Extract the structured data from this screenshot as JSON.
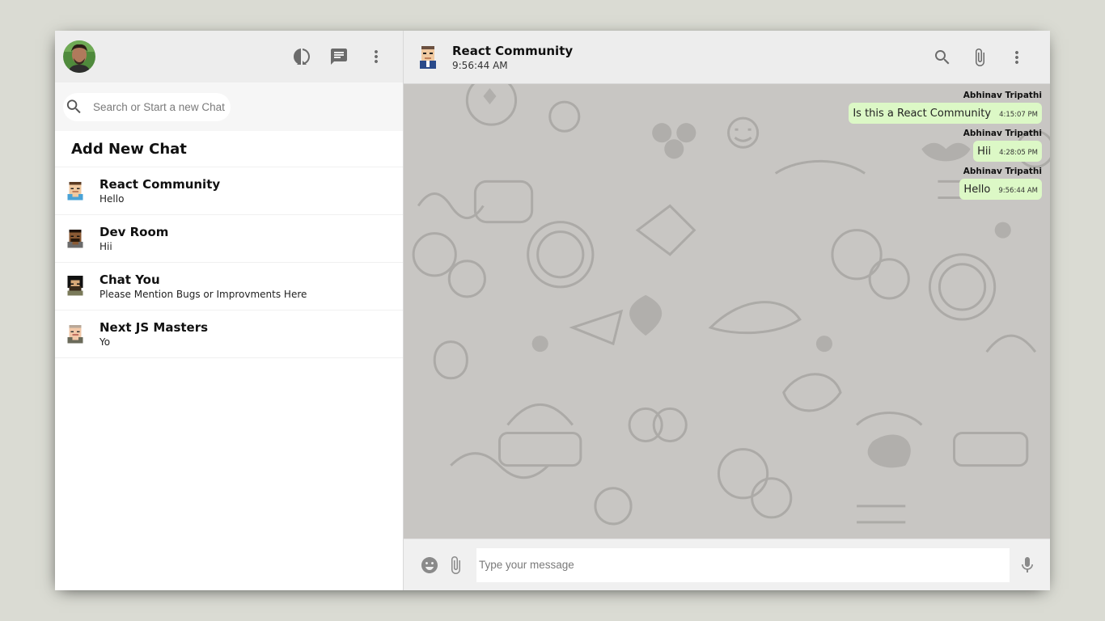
{
  "sidebar": {
    "search": {
      "placeholder": "Search or Start a new Chat"
    },
    "add_new_chat": "Add New Chat",
    "chats": [
      {
        "name": "React Community",
        "last_message": "Hello"
      },
      {
        "name": "Dev Room",
        "last_message": "Hii"
      },
      {
        "name": "Chat You",
        "last_message": "Please Mention Bugs or Improvments Here"
      },
      {
        "name": "Next JS Masters",
        "last_message": "Yo"
      }
    ]
  },
  "chat": {
    "room_name": "React Community",
    "last_seen": "9:56:44 AM",
    "messages": [
      {
        "author": "Abhinav Tripathi",
        "text": "Is this a React Community",
        "time": "4:15:07 PM"
      },
      {
        "author": "Abhinav Tripathi",
        "text": "Hii",
        "time": "4:28:05 PM"
      },
      {
        "author": "Abhinav Tripathi",
        "text": "Hello",
        "time": "9:56:44 AM"
      }
    ],
    "input": {
      "placeholder": "Type your message",
      "value": ""
    }
  },
  "icons": {
    "status": "status-icon",
    "new_chat": "chat-icon",
    "menu": "more-vert-icon",
    "search": "search-icon",
    "attach": "attach-icon",
    "emoji": "emoji-icon",
    "mic": "mic-icon"
  },
  "colors": {
    "bubble": "#dcf8c6",
    "header": "#ededed",
    "wallpaper": "#c8c6c3"
  }
}
